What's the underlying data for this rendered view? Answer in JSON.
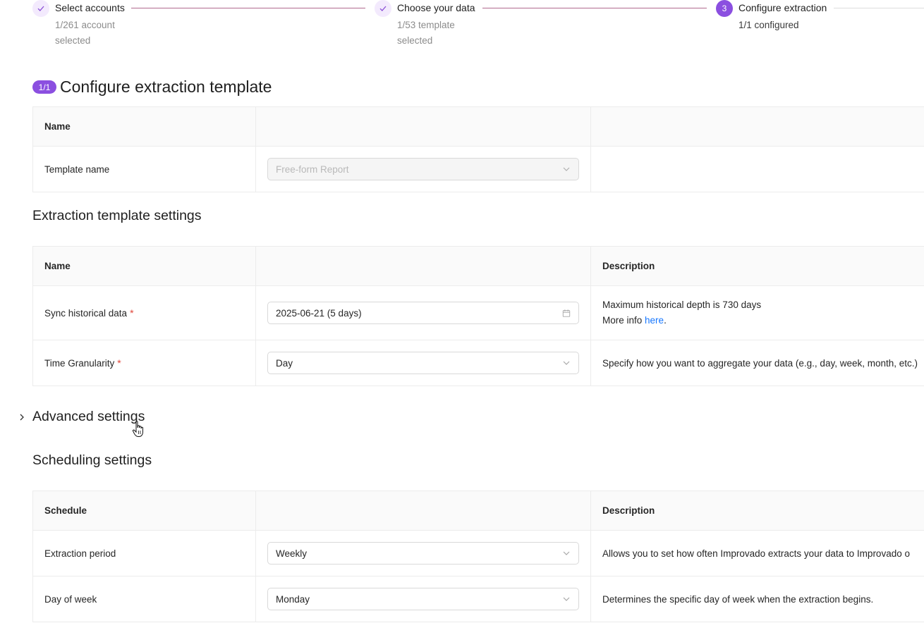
{
  "steps": [
    {
      "title": "Select accounts",
      "subtitle": "1/261 account selected",
      "state": "done"
    },
    {
      "title": "Choose your data",
      "subtitle": "1/53 template selected",
      "state": "done"
    },
    {
      "title": "Configure extraction",
      "subtitle": "1/1 configured",
      "state": "active",
      "number": "3"
    }
  ],
  "template_section": {
    "badge": "1/1",
    "title": "Configure extraction template",
    "header": {
      "name": "Name"
    },
    "row": {
      "label": "Template name",
      "value": "Free-form Report"
    }
  },
  "extraction_settings": {
    "title": "Extraction template settings",
    "header": {
      "name": "Name",
      "description": "Description"
    },
    "rows": [
      {
        "label": "Sync historical data",
        "required": "*",
        "value": "2025-06-21 (5 days)",
        "description_line1": "Maximum historical depth is 730 days",
        "description_prefix": "More info ",
        "description_link": "here",
        "description_suffix": "."
      },
      {
        "label": "Time Granularity",
        "required": "*",
        "value": "Day",
        "description": "Specify how you want to aggregate your data (e.g., day, week, month, etc.)"
      }
    ]
  },
  "advanced_settings": {
    "title": "Advanced settings"
  },
  "scheduling": {
    "title": "Scheduling settings",
    "header": {
      "name": "Schedule",
      "description": "Description"
    },
    "rows": [
      {
        "label": "Extraction period",
        "value": "Weekly",
        "description": "Allows you to set how often Improvado extracts your data to Improvado o"
      },
      {
        "label": "Day of week",
        "value": "Monday",
        "description": "Determines the specific day of week when the extraction begins."
      }
    ]
  },
  "colors": {
    "accent": "#8b4fe0",
    "link": "#1677ff",
    "required": "#e0463a"
  }
}
